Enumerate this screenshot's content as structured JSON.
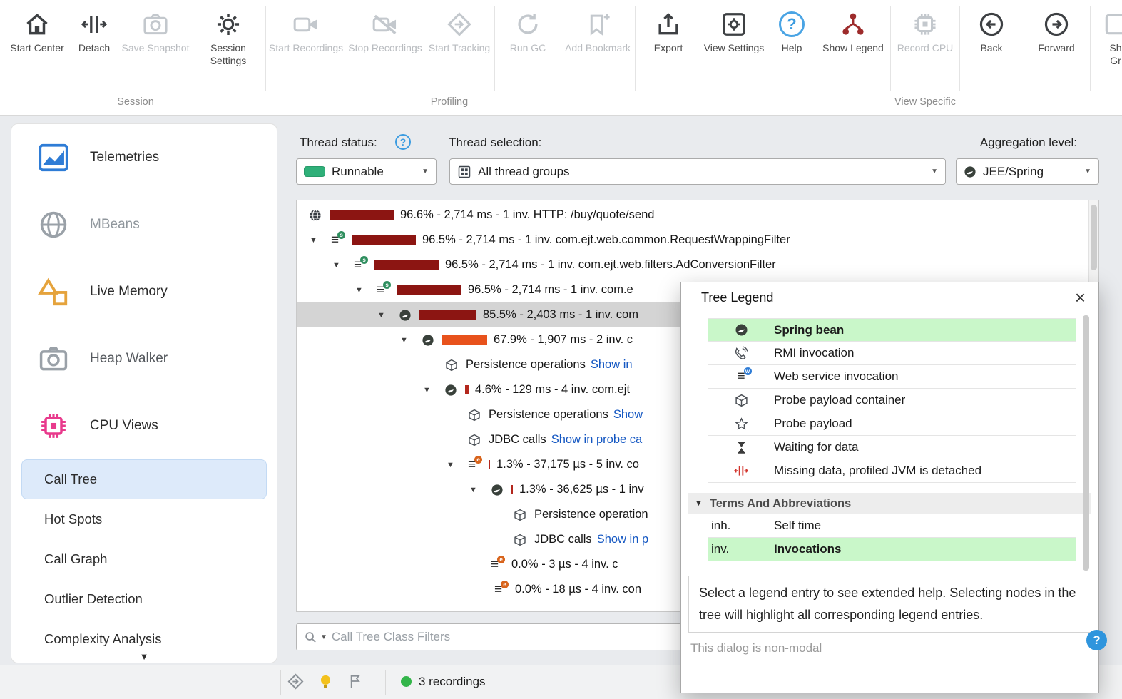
{
  "toolbar": {
    "groups": [
      {
        "label": "Session"
      },
      {
        "label": "Profiling"
      },
      {
        "label": "View Specific"
      }
    ],
    "buttons": [
      {
        "label": "Start Center",
        "enabled": true
      },
      {
        "label": "Detach",
        "enabled": true
      },
      {
        "label": "Save Snapshot",
        "enabled": false
      },
      {
        "label": "Session Settings",
        "enabled": true
      },
      {
        "label": "Start Recordings",
        "enabled": false
      },
      {
        "label": "Stop Recordings",
        "enabled": false
      },
      {
        "label": "Start Tracking",
        "enabled": false
      },
      {
        "label": "Run GC",
        "enabled": false
      },
      {
        "label": "Add Bookmark",
        "enabled": false
      },
      {
        "label": "Export",
        "enabled": true
      },
      {
        "label": "View Settings",
        "enabled": true
      },
      {
        "label": "Help",
        "enabled": true
      },
      {
        "label": "Show Legend",
        "enabled": true
      },
      {
        "label": "Record CPU",
        "enabled": false
      },
      {
        "label": "Back",
        "enabled": true
      },
      {
        "label": "Forward",
        "enabled": true
      },
      {
        "label": "Sh Gr",
        "enabled": true
      }
    ]
  },
  "sidebar": {
    "views": [
      {
        "label": "Telemetries"
      },
      {
        "label": "MBeans"
      },
      {
        "label": "Live Memory"
      },
      {
        "label": "Heap Walker"
      },
      {
        "label": "CPU Views"
      }
    ],
    "cpu_items": [
      {
        "label": "Call Tree",
        "selected": true
      },
      {
        "label": "Hot Spots"
      },
      {
        "label": "Call Graph"
      },
      {
        "label": "Outlier Detection"
      },
      {
        "label": "Complexity Analysis"
      }
    ]
  },
  "controls": {
    "thread_status_label": "Thread status:",
    "thread_status_value": "Runnable",
    "thread_selection_label": "Thread selection:",
    "thread_selection_value": "All thread groups",
    "aggregation_label": "Aggregation level:",
    "aggregation_value": "JEE/Spring"
  },
  "tree": {
    "rows": [
      {
        "text": "96.6% - 2,714 ms - 1 inv. HTTP: /buy/quote/send",
        "row_style": "padding-left:17px",
        "bar_style": "width:90px;background:#8c1512"
      },
      {
        "text": "96.5% - 2,714 ms - 1 inv. com.ejt.web.common.RequestWrappingFilter",
        "row_style": "padding-left:18px",
        "bar_style": "width:90px;background:#8c1512"
      },
      {
        "text": "96.5% - 2,714 ms - 1 inv. com.ejt.web.filters.AdConversionFilter",
        "row_style": "padding-left:50px",
        "bar_style": "width:90px;background:#8c1512"
      },
      {
        "text": "96.5% - 2,714 ms - 1 inv. com.e",
        "row_style": "padding-left:82px",
        "bar_style": "width:90px;background:#8c1512"
      },
      {
        "text": "85.5% - 2,403 ms - 1 inv. com",
        "row_style": "padding-left:113px",
        "bar_style": "width:80px;background:#8c1512",
        "selected": true
      },
      {
        "text": "67.9% - 1,907 ms - 2 inv. c",
        "row_style": "padding-left:145px",
        "bar_style": "width:63px;background:#e8521c"
      },
      {
        "text": "Persistence operations",
        "link": "Show in",
        "row_style": "padding-left:208px",
        "bar_style": "display:none"
      },
      {
        "text": "4.6% - 129 ms - 4 inv. com.ejt",
        "row_style": "padding-left:177px",
        "bar_style": "width:5px;background:#b3271d"
      },
      {
        "text": "Persistence operations",
        "link": "Show",
        "row_style": "padding-left:240px",
        "bar_style": "display:none"
      },
      {
        "text": "JDBC calls",
        "link": "Show in probe ca",
        "row_style": "padding-left:240px",
        "bar_style": "display:none"
      },
      {
        "text": "1.3% - 37,175 µs - 5 inv. co",
        "row_style": "padding-left:210px",
        "bar_style": "width:2px;background:#b3271d"
      },
      {
        "text": "1.3% - 36,625 µs - 1 inv",
        "row_style": "padding-left:242px",
        "bar_style": "width:2px;background:#b3271d"
      },
      {
        "text": "Persistence operation",
        "row_style": "padding-left:304px",
        "bar_style": "display:none"
      },
      {
        "text": "JDBC calls",
        "link": "Show in p",
        "row_style": "padding-left:304px",
        "bar_style": "display:none"
      },
      {
        "text": "0.0% - 3 µs - 4 inv. c",
        "row_style": "padding-left:272px",
        "bar_style": "display:none"
      },
      {
        "text": "0.0% - 18 µs - 4 inv. con",
        "row_style": "padding-left:277px",
        "bar_style": "display:none"
      }
    ]
  },
  "filter": {
    "placeholder": "Call Tree Class Filters"
  },
  "statusbar": {
    "recordings": "3 recordings"
  },
  "legend": {
    "title": "Tree Legend",
    "close": "×",
    "entries": [
      {
        "label": "Spring bean",
        "highlighted": true
      },
      {
        "label": "RMI invocation"
      },
      {
        "label": "Web service invocation"
      },
      {
        "label": "Probe payload container"
      },
      {
        "label": "Probe payload"
      },
      {
        "label": "Waiting for data"
      },
      {
        "label": "Missing data, profiled JVM is detached"
      }
    ],
    "terms_header": "Terms And Abbreviations",
    "terms": [
      {
        "abbr": "inh.",
        "label": "Self time"
      },
      {
        "abbr": "inv.",
        "label": "Invocations",
        "highlighted": true
      }
    ],
    "help_text": "Select a legend entry to see extended help. Selecting nodes in the tree will highlight all corresponding legend entries.",
    "footer": "This dialog is non-modal"
  },
  "colors": {
    "bar_dark": "#8c1512",
    "bar_orange": "#e8521c",
    "legend_highlight": "#c9f7c9",
    "selected_row": "#d4d4d4",
    "runnable_green": "#2fb079",
    "accent_blue": "#2f95dd"
  }
}
